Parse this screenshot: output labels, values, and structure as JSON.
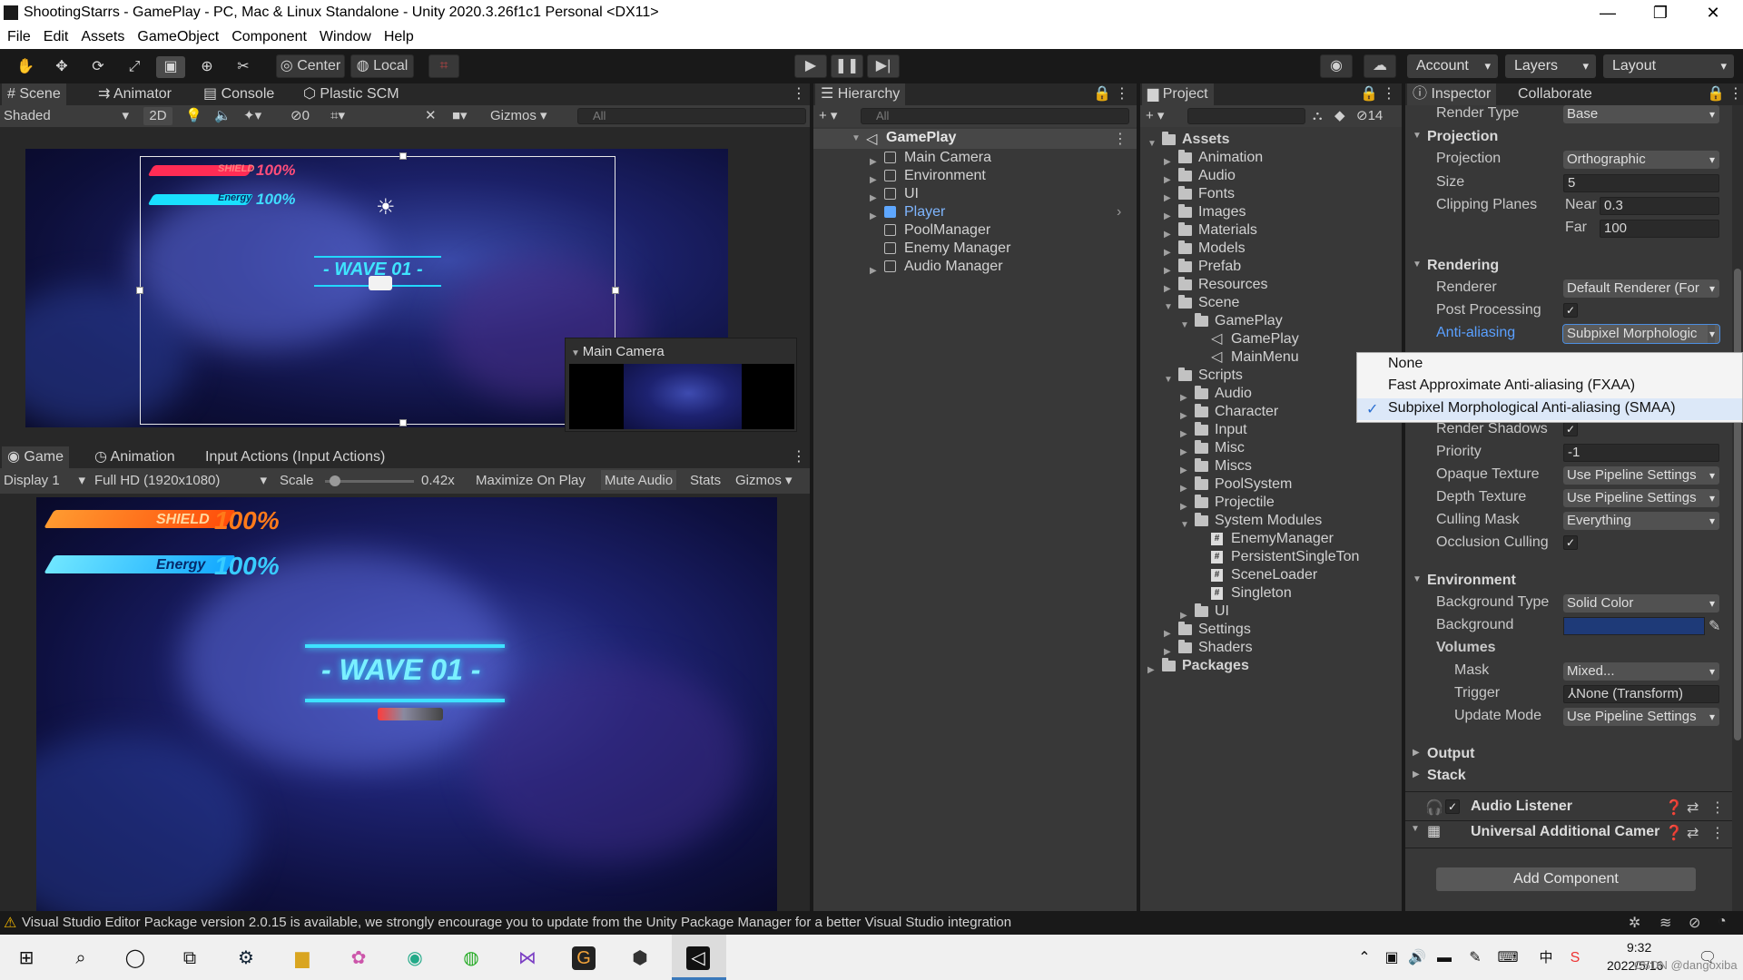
{
  "window": {
    "title": "ShootingStarrs - GamePlay - PC, Mac & Linux Standalone - Unity 2020.3.26f1c1 Personal <DX11>",
    "min_glyph": "—",
    "max_glyph": "❐",
    "close_glyph": "✕"
  },
  "menu": [
    "File",
    "Edit",
    "Assets",
    "GameObject",
    "Component",
    "Window",
    "Help"
  ],
  "toolbar": {
    "center_label": "Center",
    "local_label": "Local",
    "account_label": "Account",
    "layers_label": "Layers",
    "layout_label": "Layout"
  },
  "scene_panel": {
    "tabs": [
      "Scene",
      "Animator",
      "Console",
      "Plastic SCM"
    ],
    "shading_mode": "Shaded",
    "mode_2d": "2D",
    "hidden_count": "0",
    "gizmos_label": "Gizmos",
    "search_placeholder": "All",
    "shield_text": "SHIELD",
    "shield_pct": "100%",
    "energy_text": "Energy",
    "energy_pct": "100%",
    "wave_text": "- WAVE 01 -",
    "camera_preview_title": "Main Camera"
  },
  "game_panel": {
    "tabs": [
      "Game",
      "Animation",
      "Input Actions (Input Actions)"
    ],
    "display": "Display 1",
    "resolution": "Full HD (1920x1080)",
    "scale_label": "Scale",
    "scale_value": "0.42x",
    "maximize_label": "Maximize On Play",
    "mute_label": "Mute Audio",
    "stats_label": "Stats",
    "gizmos_label": "Gizmos",
    "shield_text": "SHIELD",
    "shield_pct": "100%",
    "energy_text": "Energy",
    "energy_pct": "100%",
    "wave_text": "- WAVE 01 -",
    "scale_fraction": 0.05
  },
  "hierarchy": {
    "title": "Hierarchy",
    "search_placeholder": "All",
    "scene_name": "GamePlay",
    "items": [
      {
        "label": "Main Camera",
        "expandable": true,
        "selected": true
      },
      {
        "label": "Environment",
        "expandable": true
      },
      {
        "label": "UI",
        "expandable": true
      },
      {
        "label": "Player",
        "expandable": true,
        "prefab": true
      },
      {
        "label": "PoolManager",
        "expandable": false
      },
      {
        "label": "Enemy Manager",
        "expandable": false
      },
      {
        "label": "Audio Manager",
        "expandable": true
      }
    ]
  },
  "project": {
    "title": "Project",
    "hidden_count": "14",
    "items": [
      {
        "label": "Assets",
        "depth": 0,
        "open": true,
        "kind": "folder",
        "bold": true
      },
      {
        "label": "Animation",
        "depth": 1,
        "kind": "folder"
      },
      {
        "label": "Audio",
        "depth": 1,
        "kind": "folder"
      },
      {
        "label": "Fonts",
        "depth": 1,
        "kind": "folder"
      },
      {
        "label": "Images",
        "depth": 1,
        "kind": "folder"
      },
      {
        "label": "Materials",
        "depth": 1,
        "kind": "folder"
      },
      {
        "label": "Models",
        "depth": 1,
        "kind": "folder"
      },
      {
        "label": "Prefab",
        "depth": 1,
        "kind": "folder"
      },
      {
        "label": "Resources",
        "depth": 1,
        "kind": "folder"
      },
      {
        "label": "Scene",
        "depth": 1,
        "open": true,
        "kind": "folder"
      },
      {
        "label": "GamePlay",
        "depth": 2,
        "open": true,
        "kind": "folder"
      },
      {
        "label": "GamePlay",
        "depth": 3,
        "kind": "scene",
        "leaf": true
      },
      {
        "label": "MainMenu",
        "depth": 3,
        "kind": "scene",
        "leaf": true
      },
      {
        "label": "Scripts",
        "depth": 1,
        "open": true,
        "kind": "folder"
      },
      {
        "label": "Audio",
        "depth": 2,
        "kind": "folder"
      },
      {
        "label": "Character",
        "depth": 2,
        "kind": "folder"
      },
      {
        "label": "Input",
        "depth": 2,
        "kind": "folder"
      },
      {
        "label": "Misc",
        "depth": 2,
        "kind": "folder"
      },
      {
        "label": "Miscs",
        "depth": 2,
        "kind": "folder"
      },
      {
        "label": "PoolSystem",
        "depth": 2,
        "kind": "folder"
      },
      {
        "label": "Projectile",
        "depth": 2,
        "kind": "folder"
      },
      {
        "label": "System Modules",
        "depth": 2,
        "open": true,
        "kind": "folder"
      },
      {
        "label": "EnemyManager",
        "depth": 3,
        "kind": "script",
        "leaf": true
      },
      {
        "label": "PersistentSingleTon",
        "depth": 3,
        "kind": "script",
        "leaf": true
      },
      {
        "label": "SceneLoader",
        "depth": 3,
        "kind": "script",
        "leaf": true
      },
      {
        "label": "Singleton",
        "depth": 3,
        "kind": "script",
        "leaf": true
      },
      {
        "label": "UI",
        "depth": 2,
        "kind": "folder"
      },
      {
        "label": "Settings",
        "depth": 1,
        "kind": "folder"
      },
      {
        "label": "Shaders",
        "depth": 1,
        "kind": "folder"
      },
      {
        "label": "Packages",
        "depth": 0,
        "kind": "folder",
        "bold": true
      }
    ]
  },
  "inspector": {
    "tabs": [
      "Inspector",
      "Collaborate"
    ],
    "render_type_label": "Render Type",
    "render_type": "Base",
    "projection_header": "Projection",
    "projection_label": "Projection",
    "projection_value": "Orthographic",
    "size_label": "Size",
    "size_value": "5",
    "clipping_label": "Clipping Planes",
    "near_label": "Near",
    "near_value": "0.3",
    "far_label": "Far",
    "far_value": "100",
    "rendering_header": "Rendering",
    "renderer_label": "Renderer",
    "renderer_value": "Default Renderer (For",
    "post_label": "Post Processing",
    "check": "✓",
    "aa_label": "Anti-aliasing",
    "aa_value": "Subpixel Morphologic",
    "aa_options": [
      "None",
      "Fast Approximate Anti-aliasing (FXAA)",
      "Subpixel Morphological Anti-aliasing (SMAA)"
    ],
    "shadows_label": "Render Shadows",
    "priority_label": "Priority",
    "priority_value": "-1",
    "opaque_label": "Opaque Texture",
    "opaque_value": "Use Pipeline Settings",
    "depth_label": "Depth Texture",
    "depth_value": "Use Pipeline Settings",
    "culling_label": "Culling Mask",
    "culling_value": "Everything",
    "occlusion_label": "Occlusion Culling",
    "environment_header": "Environment",
    "bgtype_label": "Background Type",
    "bgtype_value": "Solid Color",
    "bg_label": "Background",
    "bg_color": "#1e3a78",
    "volumes_label": "Volumes",
    "mask_label": "Mask",
    "mask_value": "Mixed...",
    "trigger_label": "Trigger",
    "trigger_value": "None (Transform)",
    "update_label": "Update Mode",
    "update_value": "Use Pipeline Settings",
    "output_header": "Output",
    "stack_header": "Stack",
    "audio_listener": "Audio Listener",
    "universal_camera": "Universal Additional Camer",
    "add_component": "Add Component"
  },
  "status_bar": {
    "message": "Visual Studio Editor Package version 2.0.15 is available, we strongly encourage you to update from the Unity Package Manager for a better Visual Studio integration"
  },
  "taskbar": {
    "time": "9:32",
    "date": "2022/5/16",
    "ime": "中",
    "watermark": "CSDN @dangoxiba"
  },
  "colors": {
    "accent": "#3a79bb",
    "cyan": "#1de0ff",
    "orange": "#ff6a1a",
    "prefab_blue": "#7fb6ff"
  }
}
